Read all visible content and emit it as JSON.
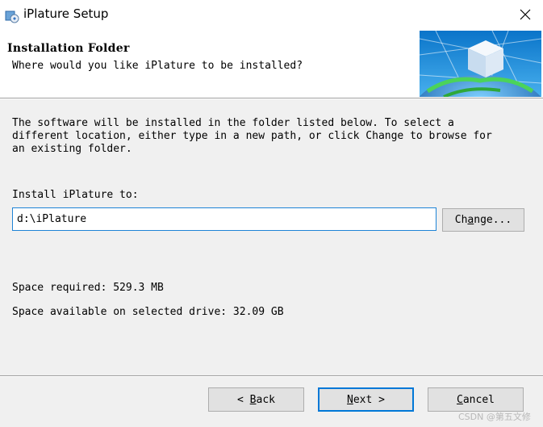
{
  "window": {
    "title": "iPlature Setup",
    "close_glyph": "✕",
    "icon": "installer-icon"
  },
  "header": {
    "title": "Installation Folder",
    "subtitle": "Where would you like iPlature to be installed?",
    "graphic": "globe-cube-banner"
  },
  "main": {
    "description": "The software will be installed in the folder listed below. To select a\ndifferent location, either type in a new path, or click Change to browse for\nan existing folder.",
    "install_label": "Install iPlature to:",
    "install_path": "d:\\iPlature",
    "change_button": {
      "prefix": "Ch",
      "mnemonic": "a",
      "suffix": "nge..."
    },
    "space_required": "Space required: 529.3 MB",
    "space_available": "Space available on selected drive: 32.09 GB"
  },
  "footer": {
    "back_button": {
      "prefix": "< ",
      "mnemonic": "B",
      "suffix": "ack"
    },
    "next_button": {
      "prefix": "",
      "mnemonic": "N",
      "suffix": "ext >"
    },
    "cancel_button": {
      "prefix": "",
      "mnemonic": "C",
      "suffix": "ancel"
    },
    "watermark": "CSDN @第五文修"
  },
  "colors": {
    "accent": "#0078d7",
    "input_border": "#1e84d6",
    "body_bg": "#f0f0f0",
    "button_bg": "#e1e1e1"
  }
}
